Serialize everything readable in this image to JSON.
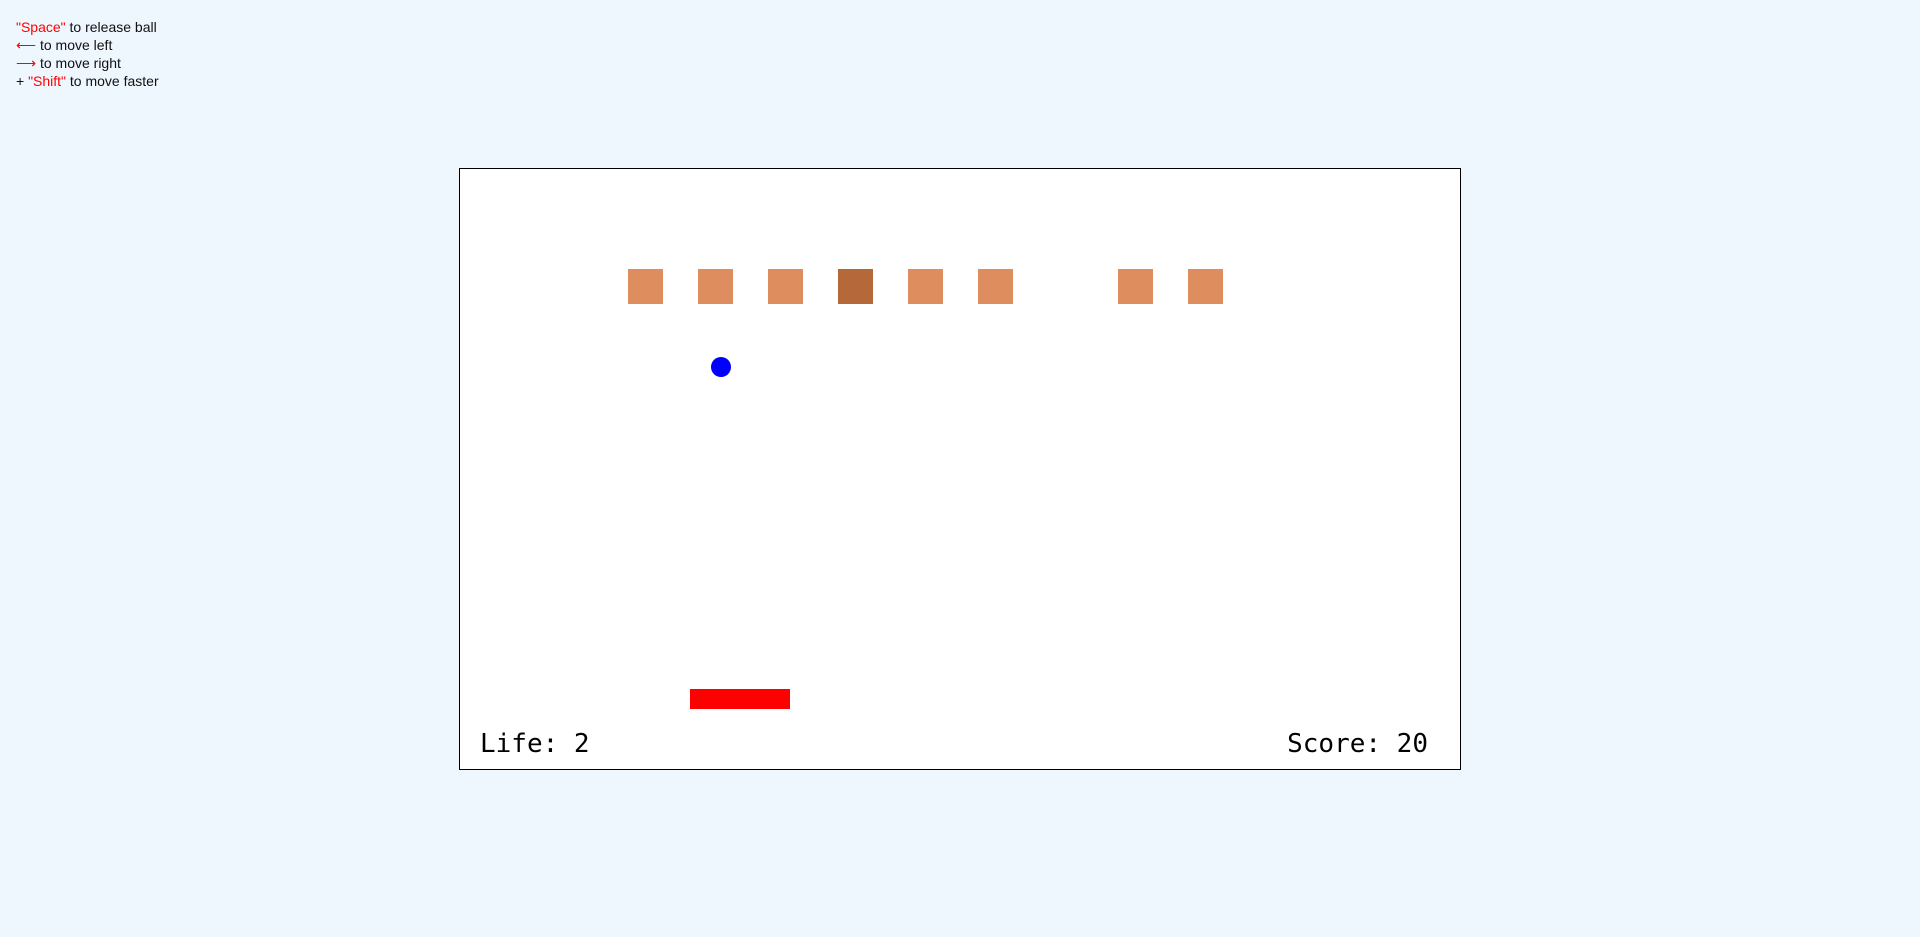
{
  "instructions": {
    "space": {
      "key": "\"Space\"",
      "text": " to release ball"
    },
    "left": {
      "key": "⟵",
      "text": " to move left"
    },
    "right": {
      "key": "⟶",
      "text": " to move right"
    },
    "shift": {
      "prefix": "+ ",
      "key": "\"Shift\"",
      "text": " to move faster"
    }
  },
  "hud": {
    "life": "Life: 2",
    "score": "Score: 20"
  },
  "colors": {
    "background": "#eef6fe",
    "brick": "#de8d5e",
    "brick_hard": "#b5683a",
    "ball": "#0000ff",
    "paddle": "#ff0000",
    "key_highlight": "#ff0000"
  }
}
